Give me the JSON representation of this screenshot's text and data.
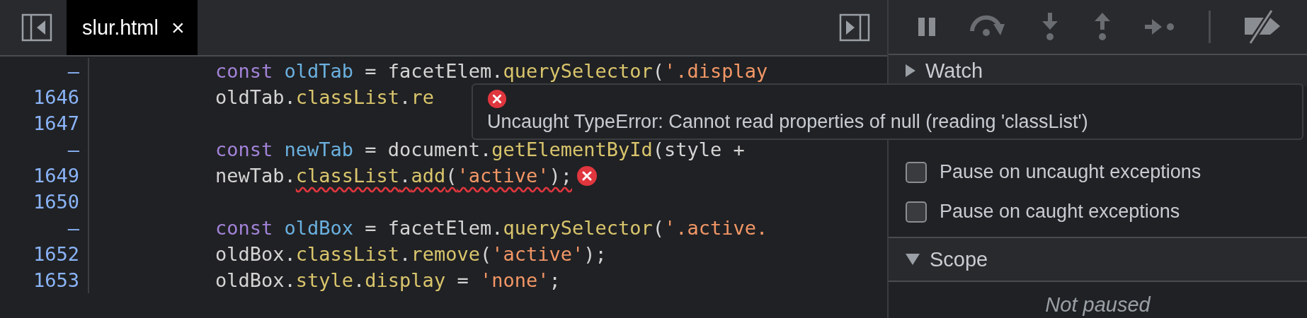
{
  "editor": {
    "tabs": [
      {
        "label": "slur.html",
        "close": "×",
        "selected": true
      }
    ],
    "lines": [
      {
        "number": "–",
        "tokens": [
          {
            "kind": "keyword",
            "text": "const "
          },
          {
            "kind": "variable",
            "text": "oldTab"
          },
          {
            "kind": "plain",
            "text": " = facetElem."
          },
          {
            "kind": "method",
            "text": "querySelector"
          },
          {
            "kind": "plain",
            "text": "("
          },
          {
            "kind": "string",
            "text": "'.display"
          }
        ]
      },
      {
        "number": "1646",
        "tokens": [
          {
            "kind": "plain",
            "text": "oldTab."
          },
          {
            "kind": "method",
            "text": "classList"
          },
          {
            "kind": "plain",
            "text": "."
          },
          {
            "kind": "method",
            "text": "re"
          }
        ]
      },
      {
        "number": "1647"
      },
      {
        "number": "–",
        "tokens": [
          {
            "kind": "keyword",
            "text": "const "
          },
          {
            "kind": "variable",
            "text": "newTab"
          },
          {
            "kind": "plain",
            "text": " = document."
          },
          {
            "kind": "method",
            "text": "getElementById"
          },
          {
            "kind": "plain",
            "text": "(style +"
          }
        ]
      },
      {
        "number": "1649",
        "error_marker": true,
        "tokens": [
          {
            "kind": "plain",
            "text": "newTab."
          },
          {
            "kind": "method",
            "text": "classList",
            "squiggle": true
          },
          {
            "kind": "plain",
            "text": ".",
            "squiggle": true
          },
          {
            "kind": "method",
            "text": "add",
            "squiggle": true
          },
          {
            "kind": "plain",
            "text": "(",
            "squiggle": true
          },
          {
            "kind": "string",
            "text": "'active'",
            "squiggle": true
          },
          {
            "kind": "plain",
            "text": ");",
            "squiggle": true
          }
        ]
      },
      {
        "number": "1650"
      },
      {
        "number": "–",
        "tokens": [
          {
            "kind": "keyword",
            "text": "const "
          },
          {
            "kind": "variable",
            "text": "oldBox"
          },
          {
            "kind": "plain",
            "text": " = facetElem."
          },
          {
            "kind": "method",
            "text": "querySelector"
          },
          {
            "kind": "plain",
            "text": "("
          },
          {
            "kind": "string",
            "text": "'.active."
          }
        ]
      },
      {
        "number": "1652",
        "tokens": [
          {
            "kind": "plain",
            "text": "oldBox."
          },
          {
            "kind": "method",
            "text": "classList"
          },
          {
            "kind": "plain",
            "text": "."
          },
          {
            "kind": "method",
            "text": "remove"
          },
          {
            "kind": "plain",
            "text": "("
          },
          {
            "kind": "string",
            "text": "'active'"
          },
          {
            "kind": "plain",
            "text": ");"
          }
        ]
      },
      {
        "number": "1653",
        "tokens": [
          {
            "kind": "plain",
            "text": "oldBox."
          },
          {
            "kind": "method",
            "text": "style"
          },
          {
            "kind": "plain",
            "text": "."
          },
          {
            "kind": "method",
            "text": "display"
          },
          {
            "kind": "plain",
            "text": " = "
          },
          {
            "kind": "string",
            "text": "'none'"
          },
          {
            "kind": "plain",
            "text": ";"
          }
        ]
      }
    ]
  },
  "tooltip": {
    "message": "Uncaught TypeError: Cannot read properties of null (reading 'classList')"
  },
  "debugger": {
    "toolbar": [
      {
        "kind": "pause"
      },
      {
        "kind": "step-over"
      },
      {
        "kind": "step-into"
      },
      {
        "kind": "step-out"
      },
      {
        "kind": "step"
      },
      {
        "kind": "separator"
      },
      {
        "kind": "deactivate"
      }
    ],
    "sections": [
      {
        "kind": "header",
        "title": "Watch",
        "expanded": false
      },
      {
        "kind": "checkboxes",
        "items": [
          {
            "label": "Pause on uncaught exceptions",
            "checked": false
          },
          {
            "label": "Pause on caught exceptions",
            "checked": false
          }
        ]
      },
      {
        "kind": "header",
        "title": "Scope",
        "expanded": true,
        "body": "Not paused"
      }
    ]
  }
}
